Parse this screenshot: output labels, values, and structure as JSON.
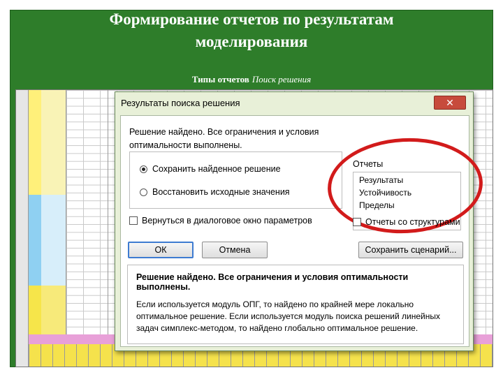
{
  "slide": {
    "title_line1": "Формирование отчетов по результатам",
    "title_line2": "моделирования",
    "subtitle_main": "Типы отчетов",
    "subtitle_italic": "Поиск решения"
  },
  "dialog": {
    "title": "Результаты поиска решения",
    "close_glyph": "✕",
    "message_top": "Решение найдено. Все ограничения и условия оптимальности выполнены.",
    "options": [
      {
        "label": "Сохранить найденное решение",
        "selected": true
      },
      {
        "label": "Восстановить исходные значения",
        "selected": false
      }
    ],
    "reports_label": "Отчеты",
    "reports": [
      "Результаты",
      "Устойчивость",
      "Пределы"
    ],
    "return_checkbox_label": "Вернуться в диалоговое окно параметров",
    "outline_checkbox_label": "Отчеты со структурами",
    "ok_label": "ОК",
    "cancel_label": "Отмена",
    "save_scenario_label": "Сохранить сценарий...",
    "info_head": "Решение найдено. Все ограничения и условия оптимальности выполнены.",
    "info_body": "Если используется модуль ОПГ, то найдено по крайней мере локально оптимальное решение. Если используется модуль поиска решений линейных задач симплекс-методом, то найдено глобально оптимальное решение."
  },
  "colors": {
    "slide_background": "#2e7d2a",
    "highlight_ellipse": "#d21b1b",
    "dialog_chrome": "#e8f0d8",
    "close_button": "#c74b3c"
  }
}
